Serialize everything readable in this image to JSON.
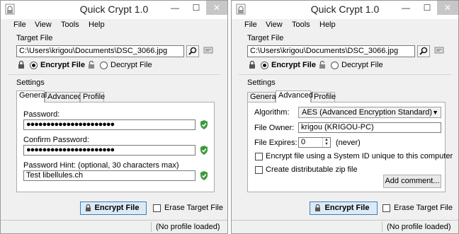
{
  "window1": {
    "title": "Quick Crypt 1.0",
    "menu": [
      "File",
      "View",
      "Tools",
      "Help"
    ],
    "target_file_label": "Target File",
    "target_file_path": "C:\\Users\\krigou\\Documents\\DSC_3066.jpg",
    "encrypt_option": "Encrypt File",
    "decrypt_option": "Decrypt File",
    "selected_mode": "encrypt",
    "settings_label": "Settings",
    "tabs": [
      "General",
      "Advanced",
      "Profile"
    ],
    "active_tab": "General",
    "password_label": "Password:",
    "password_value": "●●●●●●●●●●●●●●●●●●●●●●",
    "confirm_label": "Confirm Password:",
    "confirm_value": "●●●●●●●●●●●●●●●●●●●●●●",
    "hint_label": "Password Hint: (optional, 30 characters max)",
    "hint_value": "Test libellules.ch",
    "encrypt_button": "Encrypt File",
    "erase_label": "Erase Target File",
    "erase_checked": false,
    "status": "(No profile loaded)"
  },
  "window2": {
    "title": "Quick Crypt 1.0",
    "menu": [
      "File",
      "View",
      "Tools",
      "Help"
    ],
    "target_file_label": "Target File",
    "target_file_path": "C:\\Users\\krigou\\Documents\\DSC_3066.jpg",
    "encrypt_option": "Encrypt File",
    "decrypt_option": "Decrypt File",
    "selected_mode": "encrypt",
    "settings_label": "Settings",
    "tabs": [
      "General",
      "Advanced",
      "Profile"
    ],
    "active_tab": "Advanced",
    "algorithm_label": "Algorithm:",
    "algorithm_value": "AES (Advanced Encryption Standard)",
    "owner_label": "File Owner:",
    "owner_value": "krigou (KRIGOU-PC)",
    "expires_label": "File Expires:",
    "expires_value": "0",
    "expires_note": "(never)",
    "system_id_label": "Encrypt file using a System ID unique to this computer",
    "system_id_checked": false,
    "zip_label": "Create distributable zip file",
    "zip_checked": false,
    "add_comment_button": "Add comment...",
    "encrypt_button": "Encrypt File",
    "erase_label": "Erase Target File",
    "erase_checked": false,
    "status": "(No profile loaded)"
  },
  "colors": {
    "valid_check": "#3c9a3c",
    "primary_button_border": "#3c7fb1",
    "primary_button_bg": "#dceaf7",
    "close_button_bg": "#c7c7c7"
  },
  "icons": [
    "app-icon",
    "search-icon",
    "card-icon",
    "lock-icon",
    "unlock-icon",
    "shield-check-icon",
    "chevron-down-icon"
  ]
}
